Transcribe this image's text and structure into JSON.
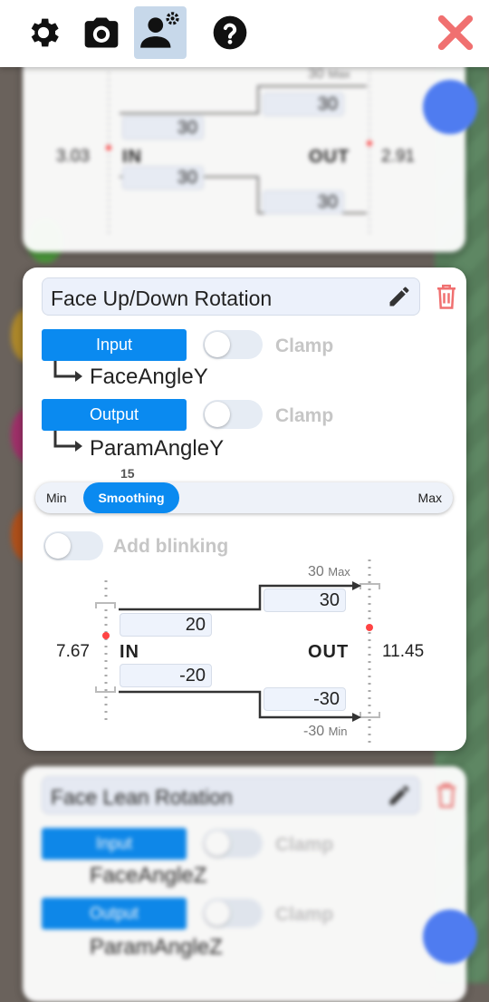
{
  "toolbar": {
    "buttons": [
      "settings-icon",
      "camera-icon",
      "user-settings-icon",
      "help-icon"
    ],
    "close_icon": "close-icon",
    "active_color": "#c7d8ea",
    "close_color": "#f07070"
  },
  "top_card": {
    "max_label": "30",
    "max_suffix": "Max",
    "in_value": "3.03",
    "out_value": "2.91",
    "in_label": "IN",
    "out_label": "OUT",
    "box_top_right": "30",
    "box_left_upper": "30",
    "box_left_lower": "30",
    "box_bottom_right": "30"
  },
  "main_card": {
    "title": "Face Up/Down Rotation",
    "input_button": "Input",
    "input_param": "FaceAngleY",
    "output_button": "Output",
    "output_param": "ParamAngleY",
    "clamp_label": "Clamp",
    "smoothing": {
      "value": "15",
      "label": "Smoothing",
      "min_label": "Min",
      "max_label": "Max"
    },
    "blink_label": "Add blinking",
    "graph": {
      "max_value": "30",
      "max_suffix": "Max",
      "min_value": "-30",
      "min_suffix": "Min",
      "in_label": "IN",
      "out_label": "OUT",
      "in_current": "7.67",
      "out_current": "11.45",
      "in_upper": "20",
      "in_lower": "-20",
      "out_upper": "30",
      "out_lower": "-30"
    },
    "accent": "#0a8af0",
    "delete_color": "#f07070"
  },
  "bottom_card": {
    "title": "Face Lean Rotation",
    "input_button": "Input",
    "input_param": "FaceAngleZ",
    "output_button": "Output",
    "output_param": "ParamAngleZ",
    "clamp_label": "Clamp"
  }
}
